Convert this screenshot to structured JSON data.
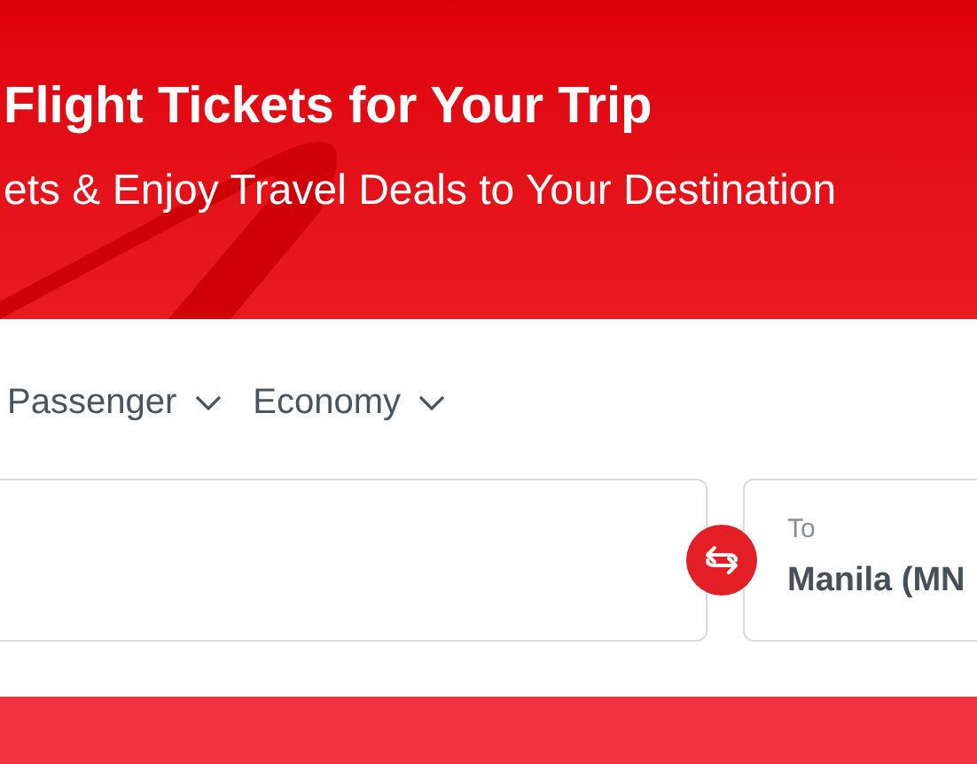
{
  "hero": {
    "title": "Flight Tickets for Your Trip",
    "subtitle": "ets & Enjoy Travel Deals to Your Destination"
  },
  "search_form": {
    "dropdowns": [
      {
        "label": "Passenger"
      },
      {
        "label": "Economy"
      }
    ],
    "to_field": {
      "label": "To",
      "value": "Manila (MN"
    }
  }
}
